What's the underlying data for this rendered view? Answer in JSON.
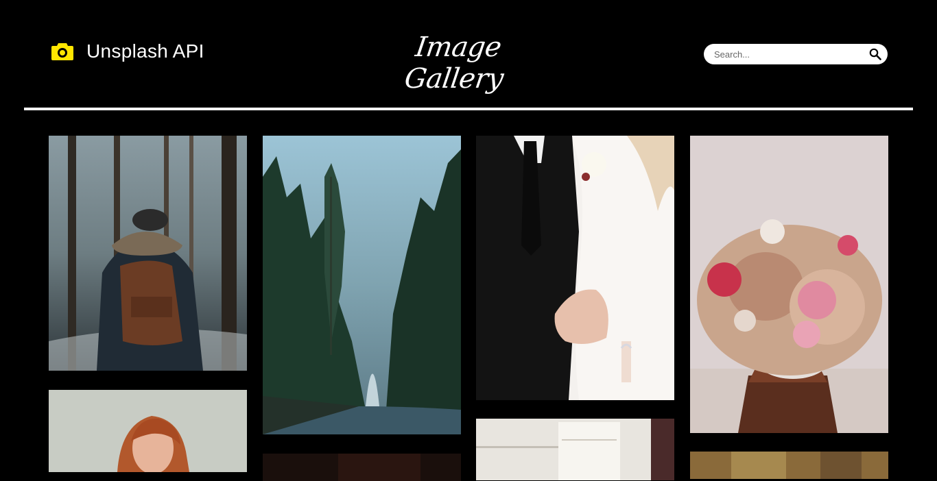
{
  "header": {
    "brand_icon": "camera-icon",
    "brand_label": "Unsplash API",
    "title": "Image Gallery",
    "search": {
      "placeholder": "Search...",
      "value": "",
      "icon": "search-icon"
    }
  },
  "colors": {
    "background": "#000000",
    "accent": "#ffe600",
    "divider": "#ffffff"
  },
  "gallery": {
    "photos": [
      {
        "subject": "person-with-backpack-in-snowy-forest"
      },
      {
        "subject": "misty-forest-river-canyon"
      },
      {
        "subject": "wedding-couple-holding-hands"
      },
      {
        "subject": "flower-bouquet-on-wooden-stand"
      },
      {
        "subject": "woman-portrait"
      },
      {
        "subject": "bright-window-interior"
      },
      {
        "subject": "dark-photo-partial"
      },
      {
        "subject": "autumn-foliage-partial"
      }
    ]
  }
}
